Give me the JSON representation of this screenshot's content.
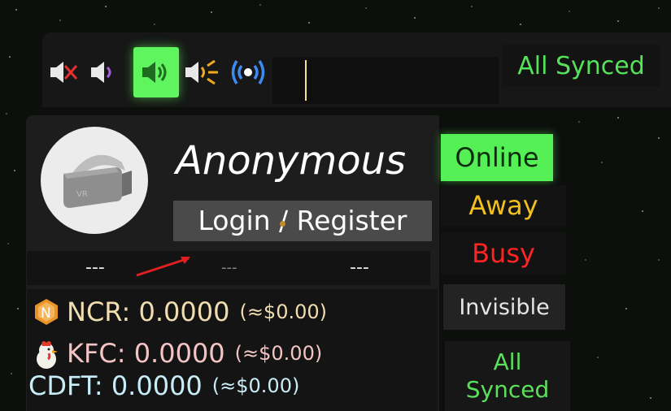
{
  "voice_modes": [
    {
      "name": "muted-icon"
    },
    {
      "name": "whisper-icon"
    },
    {
      "name": "normal-voice-icon",
      "active": true
    },
    {
      "name": "shout-icon"
    },
    {
      "name": "broadcast-icon"
    }
  ],
  "top_synced_label": "All Synced",
  "profile": {
    "username": "Anonymous",
    "login_label": "Login / Register"
  },
  "info_strip": [
    "---",
    "---",
    "---"
  ],
  "wallet": [
    {
      "symbol": "NCR",
      "text": "NCR: 0.0000",
      "approx": "(≈$0.00)",
      "color": "#f0ddb0",
      "icon": "ncr-coin-icon"
    },
    {
      "symbol": "KFC",
      "text": "KFC: 0.0000",
      "approx": "(≈$0.00)",
      "color": "#f4c4c4",
      "icon": "chicken-icon"
    },
    {
      "symbol": "CDFT",
      "text": "CDFT: 0.0000",
      "approx": "(≈$0.00)",
      "color": "#c8ecf8",
      "icon": ""
    }
  ],
  "status_options": {
    "online": "Online",
    "away": "Away",
    "busy": "Busy",
    "invisible": "Invisible",
    "synced_line1": "All",
    "synced_line2": "Synced"
  },
  "colors": {
    "accent_green": "#55f055",
    "away": "#f2bf1e",
    "busy": "#ff2424"
  }
}
